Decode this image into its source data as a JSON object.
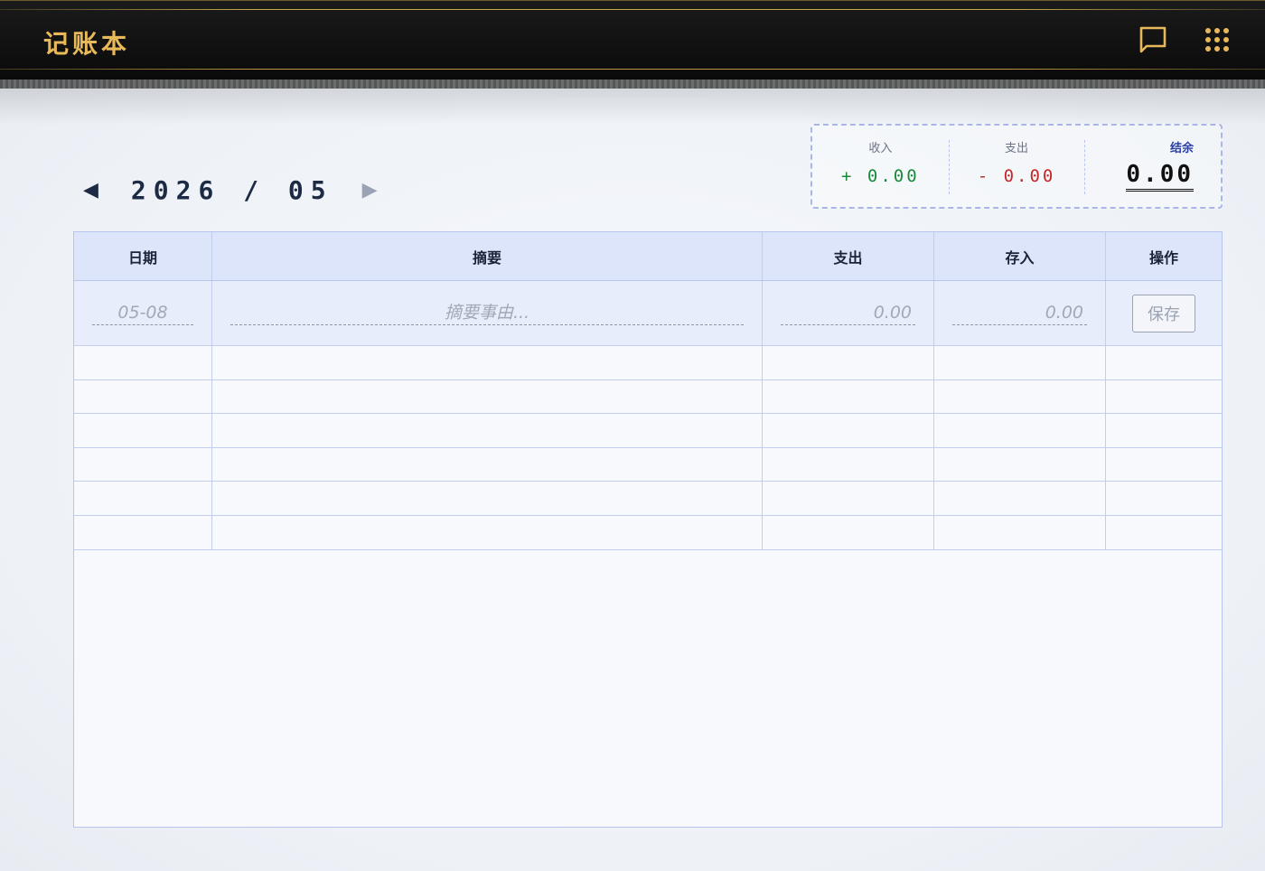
{
  "header": {
    "title": "记账本",
    "icons": [
      "chat-icon",
      "grid-menu-icon"
    ]
  },
  "month_nav": {
    "prev": "◀",
    "label": "2026 / 05",
    "next": "▶"
  },
  "summary": {
    "income_label": "收入",
    "income_value": "+ 0.00",
    "expense_label": "支出",
    "expense_value": "- 0.00",
    "balance_label": "结余",
    "balance_value": "0.00",
    "colors": {
      "income": "#1b8a3a",
      "expense": "#c62828",
      "balance_label": "#2b3ea8"
    }
  },
  "table": {
    "columns": [
      "日期",
      "摘要",
      "支出",
      "存入",
      "操作"
    ],
    "input": {
      "date_placeholder": "05-08",
      "desc_placeholder": "摘要事由...",
      "expense_placeholder": "0.00",
      "income_placeholder": "0.00",
      "save_label": "保存"
    },
    "empty_rows": 6
  },
  "colors": {
    "accent_gold": "#e8b95a",
    "header_bg": "#111111",
    "grid_line": "#c3cdf0"
  }
}
